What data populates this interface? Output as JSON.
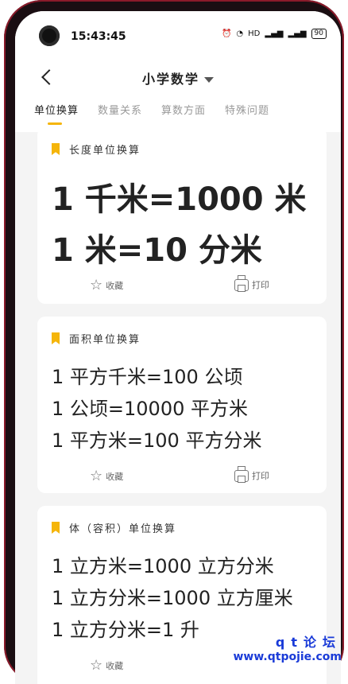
{
  "status": {
    "time": "15:43:45",
    "battery": "90"
  },
  "header": {
    "title": "小学数学",
    "tabs": [
      {
        "label": "单位换算",
        "active": true
      },
      {
        "label": "数量关系",
        "active": false
      },
      {
        "label": "算数方面",
        "active": false
      },
      {
        "label": "特殊问题",
        "active": false
      }
    ]
  },
  "cards": [
    {
      "title": "长度单位换算",
      "lines": [
        "1 千米=1000 米",
        "1 米=10 分米"
      ],
      "favorite_label": "收藏",
      "print_label": "打印"
    },
    {
      "title": "面积单位换算",
      "lines": [
        "1 平方千米=100 公顷",
        "1 公顷=10000 平方米",
        "1 平方米=100 平方分米"
      ],
      "favorite_label": "收藏",
      "print_label": "打印"
    },
    {
      "title": "体（容积）单位换算",
      "lines": [
        "1 立方米=1000 立方分米",
        "1 立方分米=1000 立方厘米",
        "1 立方分米=1 升"
      ],
      "favorite_label": "收藏",
      "print_label": ""
    }
  ],
  "watermark": {
    "line1": "qt论坛",
    "line2": "www.qtpojie.com"
  },
  "colors": {
    "accent": "#f5b50a",
    "watermark": "#1a3bd8"
  }
}
